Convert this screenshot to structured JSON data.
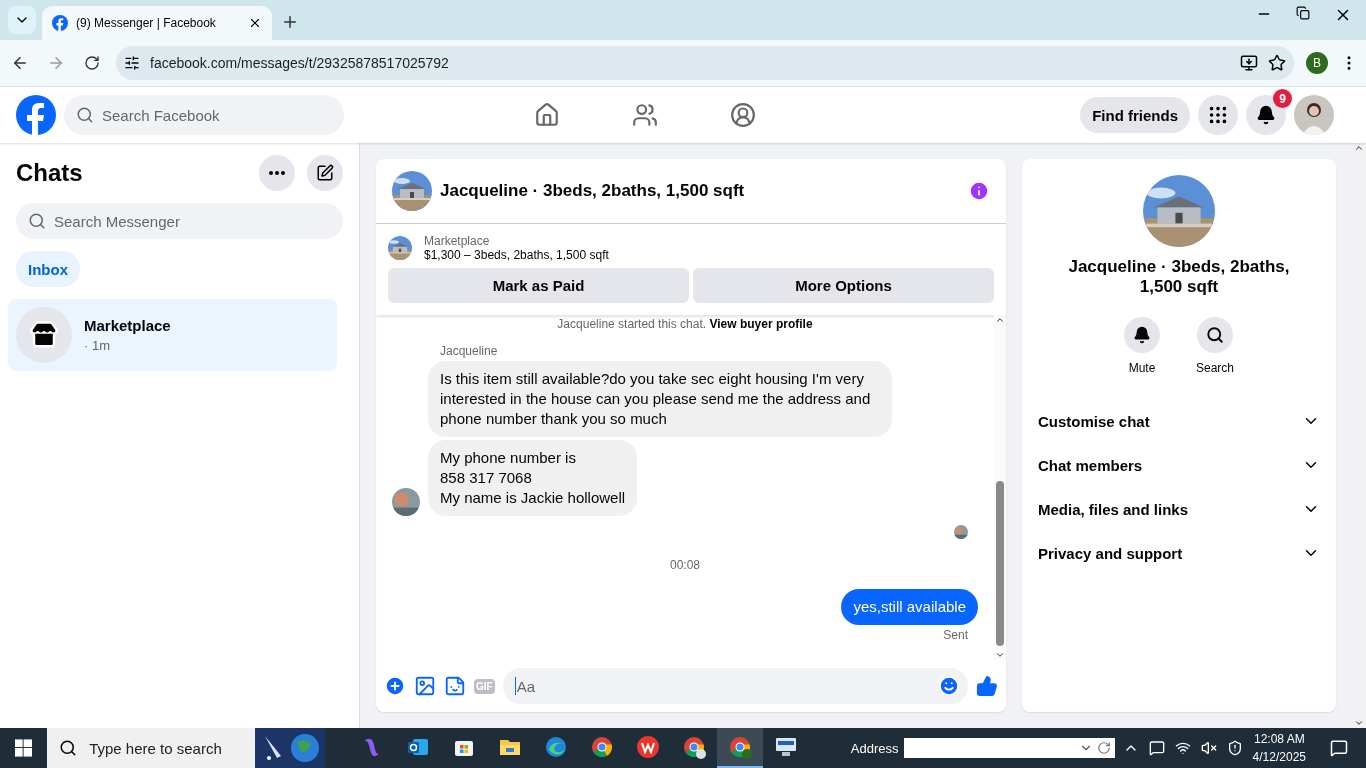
{
  "browser": {
    "tabs": [
      {
        "title": "(9) Messenger | Facebook",
        "selected": true
      }
    ],
    "url": "facebook.com/messages/t/29325878517025792",
    "profile_initial": "B"
  },
  "header": {
    "search_placeholder": "Search Facebook",
    "find_friends": "Find friends",
    "notification_count": "9"
  },
  "chats": {
    "title": "Chats",
    "search_placeholder": "Search Messenger",
    "filters": [
      {
        "label": "Inbox",
        "selected": true
      }
    ],
    "conversations": [
      {
        "name": "Marketplace",
        "time": "· 1m",
        "selected": true
      }
    ]
  },
  "conversation": {
    "title": "Jacqueline · 3beds, 2baths, 1,500 sqft",
    "listing": {
      "source": "Marketplace",
      "summary": "$1,300 – 3beds, 2baths, 1,500 sqft"
    },
    "actions": [
      "Mark as Paid",
      "More Options"
    ],
    "system_note": {
      "text": "Jacqueline started this chat.",
      "link": "View buyer profile"
    },
    "messages": [
      {
        "kind": "sender",
        "text": "Jacqueline"
      },
      {
        "kind": "incoming",
        "avatar": false,
        "text": "Is this item still available?do you take sec eight housing I'm very interested in the house can you please send me the address and phone number thank you so much"
      },
      {
        "kind": "incoming",
        "avatar": true,
        "text": "My phone number is\n858 317 7068\nMy name is Jackie hollowell"
      },
      {
        "kind": "seen"
      },
      {
        "kind": "time",
        "text": "00:08"
      },
      {
        "kind": "outgoing",
        "text": "yes,still available"
      },
      {
        "kind": "status",
        "text": "Sent"
      }
    ],
    "composer_placeholder": "Aa",
    "gif_label": "GIF"
  },
  "details": {
    "title": "Jacqueline · 3beds, 2baths, 1,500 sqft",
    "actions": [
      {
        "kind": "mute",
        "label": "Mute"
      },
      {
        "kind": "search",
        "label": "Search"
      }
    ],
    "sections": [
      {
        "label": "Customise chat",
        "expanded": false
      },
      {
        "label": "Chat members",
        "expanded": false
      },
      {
        "label": "Media, files and links",
        "expanded": false
      },
      {
        "label": "Privacy and support",
        "expanded": false
      }
    ]
  },
  "taskbar": {
    "search_placeholder": "Type here to search",
    "apps": [
      {
        "kind": "copilot",
        "selected": false
      },
      {
        "kind": "mail",
        "selected": false
      },
      {
        "kind": "store",
        "selected": false
      },
      {
        "kind": "folder",
        "selected": false
      },
      {
        "kind": "edge",
        "selected": false
      },
      {
        "kind": "chrome",
        "selected": false
      },
      {
        "kind": "office",
        "selected": false
      },
      {
        "kind": "chrome-profile",
        "selected": false
      },
      {
        "kind": "chrome-b",
        "selected": true
      },
      {
        "kind": "computer",
        "selected": false
      }
    ],
    "address_label": "Address",
    "time": "12:08 AM",
    "date": "4/12/2025"
  }
}
